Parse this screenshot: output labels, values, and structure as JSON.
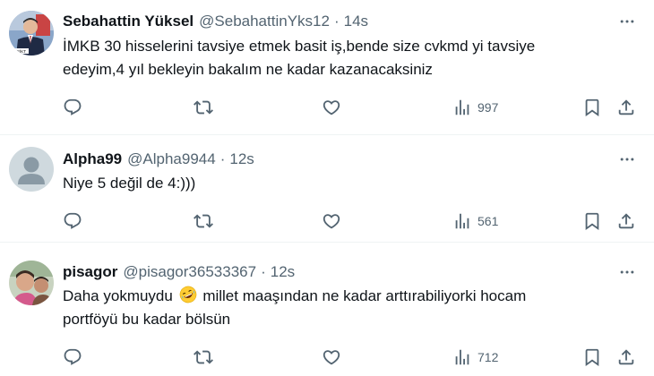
{
  "tweets": [
    {
      "name": "Sebahattin Yüksel",
      "handle": "@SebahattinYks12",
      "separator": "·",
      "time": "14s",
      "avatar_badge": "BESİKT",
      "lines": [
        "İMKB 30 hisselerini tavsiye etmek basit iş,bende size cvkmd yi tavsiye",
        "edeyim,4 yıl bekleyin bakalım ne kadar kazanacaksiniz"
      ],
      "views": "997",
      "avatar_icon": "profile-photo-man-suit-icon"
    },
    {
      "name": "Alpha99",
      "handle": "@Alpha9944",
      "separator": "·",
      "time": "12s",
      "lines": [
        "Niye 5 değil de 4:)))"
      ],
      "views": "561",
      "avatar_icon": "default-profile-icon"
    },
    {
      "name": "pisagor",
      "handle": "@pisagor36533367",
      "separator": "·",
      "time": "12s",
      "line1_before": "Daha yokmuydu",
      "line1_after": "millet maaşından ne kadar arttırabiliyorki hocam",
      "line2": "portföyü bu kadar bölsün",
      "emoji": "rolling-on-floor-laughing-emoji",
      "views": "712",
      "avatar_icon": "profile-photo-child-icon"
    }
  ],
  "colors": {
    "text": "#0f1419",
    "secondary": "#536471",
    "divider": "#eff3f4"
  },
  "icons": [
    "reply-icon",
    "retweet-icon",
    "like-icon",
    "views-icon",
    "bookmark-icon",
    "share-icon",
    "more-icon"
  ]
}
